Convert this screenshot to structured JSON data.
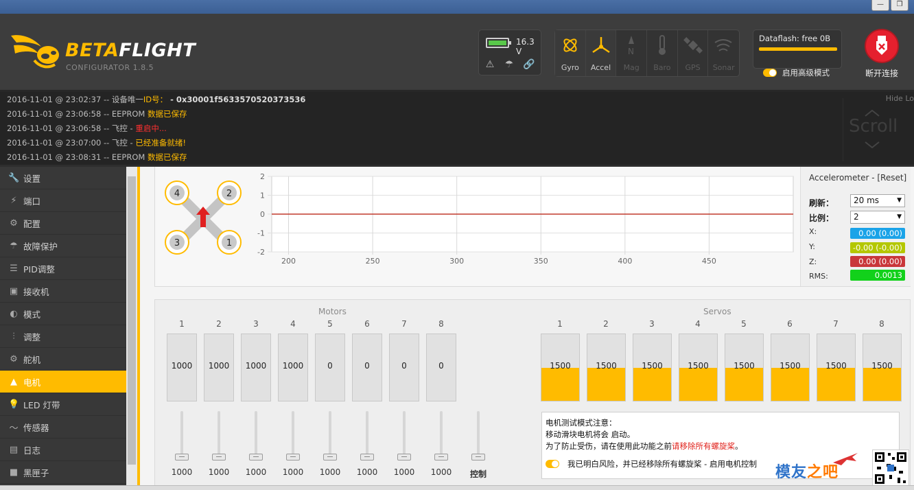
{
  "window": {
    "minimize": "—",
    "maximize": "❐"
  },
  "header": {
    "brand_part1": "BETA",
    "brand_part2": "FLIGHT",
    "subtitle": "CONFIGURATOR  1.8.5",
    "battery_voltage": "16.3 V",
    "sensors": [
      {
        "label": "Gyro",
        "active": true
      },
      {
        "label": "Accel",
        "active": true
      },
      {
        "label": "Mag",
        "active": false
      },
      {
        "label": "Baro",
        "active": false
      },
      {
        "label": "GPS",
        "active": false
      },
      {
        "label": "Sonar",
        "active": false
      }
    ],
    "dataflash": "Dataflash: free 0B",
    "expert_mode": "启用高级模式",
    "disconnect": "断开连接"
  },
  "log": {
    "hide": "Hide Lo",
    "scroll": "Scroll",
    "lines": [
      {
        "ts": "2016-11-01 @ 23:02:37 -- 设备唯一",
        "tag": "ID号：",
        "val": " - 0x30001f5633570520373536"
      },
      {
        "ts": "2016-11-01 @ 23:06:58 -- EEPROM ",
        "tag": "数据已保存",
        "val": ""
      },
      {
        "ts": "2016-11-01 @ 23:06:58 -- 飞控 - ",
        "tag": "重启中...",
        "val": ""
      },
      {
        "ts": "2016-11-01 @ 23:07:00 -- 飞控 - ",
        "tag": "已经准备就绪!",
        "val": ""
      },
      {
        "ts": "2016-11-01 @ 23:08:31 -- EEPROM ",
        "tag": "数据已保存",
        "val": ""
      }
    ]
  },
  "sidebar": {
    "items": [
      {
        "label": "设置",
        "icon": "wrench-icon",
        "glyph": "🔧"
      },
      {
        "label": "端口",
        "icon": "plug-icon",
        "glyph": "⚡"
      },
      {
        "label": "配置",
        "icon": "gear-icon",
        "glyph": "⚙"
      },
      {
        "label": "故障保护",
        "icon": "parachute-icon",
        "glyph": "☂"
      },
      {
        "label": "PID调整",
        "icon": "sliders-icon",
        "glyph": "☰"
      },
      {
        "label": "接收机",
        "icon": "receiver-icon",
        "glyph": "▣"
      },
      {
        "label": "模式",
        "icon": "toggle-icon",
        "glyph": "◐"
      },
      {
        "label": "调整",
        "icon": "adjust-icon",
        "glyph": "⫶"
      },
      {
        "label": "舵机",
        "icon": "servo-icon",
        "glyph": "⚙"
      },
      {
        "label": "电机",
        "icon": "motor-icon",
        "glyph": "▲",
        "active": true
      },
      {
        "label": "LED 灯带",
        "icon": "led-icon",
        "glyph": "💡"
      },
      {
        "label": "传感器",
        "icon": "sensor-icon",
        "glyph": "〜"
      },
      {
        "label": "日志",
        "icon": "log-icon",
        "glyph": "▤"
      },
      {
        "label": "黑匣子",
        "icon": "blackbox-icon",
        "glyph": "■"
      }
    ]
  },
  "accel": {
    "title": "Accelerometer - [Reset]",
    "refresh_label": "刷新：",
    "refresh_value": "20 ms",
    "scale_label": "比例：",
    "scale_value": "2",
    "x_label": "X:",
    "x_value": "0.00 (0.00)",
    "x_color": "#1aa3e8",
    "y_label": "Y:",
    "y_value": "-0.00 (-0.00)",
    "y_color": "#b4c700",
    "z_label": "Z:",
    "z_value": "0.00 (0.00)",
    "z_color": "#c9363a",
    "rms_label": "RMS:",
    "rms_value": "0.0013",
    "rms_color": "#12d11b"
  },
  "chart_data": {
    "type": "line",
    "x_ticks": [
      "200",
      "250",
      "300",
      "350",
      "400",
      "450"
    ],
    "y_ticks": [
      "2",
      "1",
      "0",
      "-1",
      "-2"
    ],
    "ylim": [
      -2,
      2
    ],
    "xlim": [
      190,
      500
    ],
    "series": [
      {
        "values_constant": 0,
        "color": "#c0392b"
      }
    ],
    "grid": true
  },
  "quad": {
    "motors": [
      "4",
      "2",
      "3",
      "1"
    ]
  },
  "motors": {
    "title": "Motors",
    "numbers": [
      "1",
      "2",
      "3",
      "4",
      "5",
      "6",
      "7",
      "8"
    ],
    "values": [
      "1000",
      "1000",
      "1000",
      "1000",
      "0",
      "0",
      "0",
      "0"
    ],
    "slider_values": [
      "1000",
      "1000",
      "1000",
      "1000",
      "1000",
      "1000",
      "1000",
      "1000"
    ],
    "master_label": "控制"
  },
  "servos": {
    "title": "Servos",
    "numbers": [
      "1",
      "2",
      "3",
      "4",
      "5",
      "6",
      "7",
      "8"
    ],
    "values": [
      "1500",
      "1500",
      "1500",
      "1500",
      "1500",
      "1500",
      "1500",
      "1500"
    ],
    "fill_fraction": 0.5
  },
  "notice": {
    "line1": "电机测试模式注意：",
    "line2": "移动滑块电机将会 启动。",
    "line3a": "为了防止受伤，请在使用此功能之前",
    "line3b": "请移除所有螺旋桨",
    "line3c": "。",
    "agree": "我已明白风险，并已经移除所有螺旋桨 - 启用电机控制"
  },
  "watermark": {
    "part1": "模友",
    "part2": "之吧"
  }
}
